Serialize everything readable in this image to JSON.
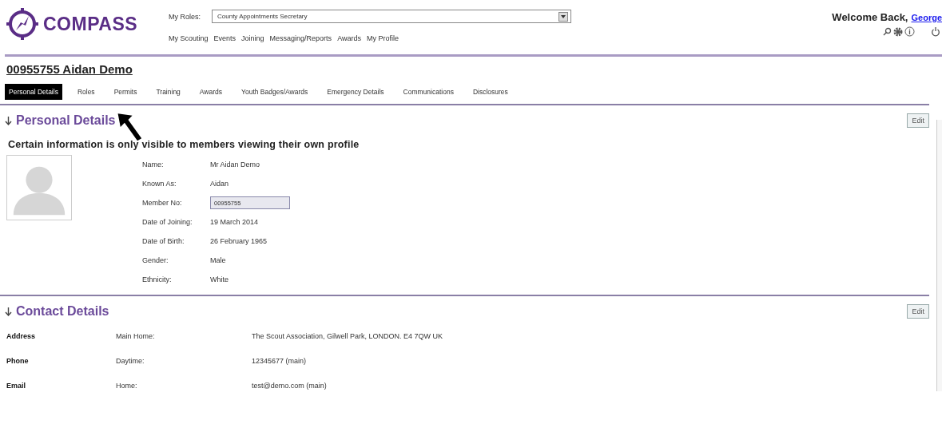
{
  "header": {
    "logo_text": "COMPASS",
    "roles_label": "My Roles:",
    "role_value": "County Appointments Secretary",
    "nav": [
      "My Scouting",
      "Events",
      "Joining",
      "Messaging/Reports",
      "Awards",
      "My Profile"
    ],
    "welcome": "Welcome Back,",
    "user_link": "George"
  },
  "member_title": "00955755 Aidan Demo",
  "tabs": [
    {
      "label": "Personal Details",
      "selected": true
    },
    {
      "label": "Roles",
      "selected": false
    },
    {
      "label": "Permits",
      "selected": false
    },
    {
      "label": "Training",
      "selected": false
    },
    {
      "label": "Awards",
      "selected": false
    },
    {
      "label": "Youth Badges/Awards",
      "selected": false
    },
    {
      "label": "Emergency Details",
      "selected": false
    },
    {
      "label": "Communications",
      "selected": false
    },
    {
      "label": "Disclosures",
      "selected": false
    }
  ],
  "personal": {
    "heading": "Personal Details",
    "edit": "Edit",
    "notice": "Certain information is only visible to members viewing their own profile",
    "fields": [
      {
        "label": "Name:",
        "value": "Mr Aidan Demo",
        "kind": "text"
      },
      {
        "label": "Known As:",
        "value": "Aidan",
        "kind": "text"
      },
      {
        "label": "Member No:",
        "value": "00955755",
        "kind": "input"
      },
      {
        "label": "Date of Joining:",
        "value": "19 March 2014",
        "kind": "text"
      },
      {
        "label": "Date of Birth:",
        "value": "26 February 1965",
        "kind": "text"
      },
      {
        "label": "Gender:",
        "value": "Male",
        "kind": "text"
      },
      {
        "label": "Ethnicity:",
        "value": "White",
        "kind": "text"
      }
    ]
  },
  "contact": {
    "heading": "Contact Details",
    "edit": "Edit",
    "rows": [
      {
        "type": "Address",
        "label": "Main Home:",
        "value": "The Scout Association, Gilwell Park, LONDON. E4 7QW UK"
      },
      {
        "type": "Phone",
        "label": "Daytime:",
        "value": "12345677 (main)"
      },
      {
        "type": "Email",
        "label": "Home:",
        "value": "test@demo.com (main)"
      }
    ]
  }
}
